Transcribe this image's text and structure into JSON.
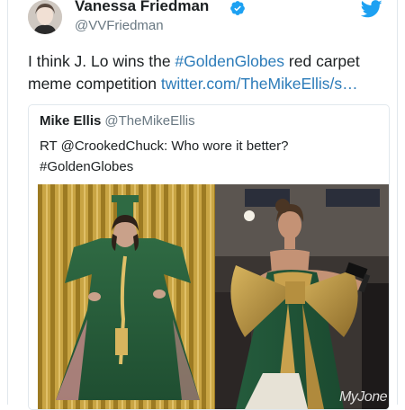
{
  "tweet": {
    "author_name": "Vanessa Friedman",
    "author_handle": "@VVFriedman",
    "text_prefix": "I think J. Lo wins the ",
    "hashtag": "#GoldenGlobes",
    "text_middle": " red carpet meme competition ",
    "link": "twitter.com/TheMikeEllis/s…"
  },
  "quoted": {
    "author_name": "Mike Ellis",
    "author_handle": "@TheMikeEllis",
    "text_line1": "RT @CrookedChuck: Who wore it better?",
    "text_line2": "#GoldenGlobes"
  },
  "media": {
    "watermark": "MyJone"
  },
  "colors": {
    "link": "#2b7bb9",
    "twitter_blue": "#1da1f2",
    "text": "#1c2022",
    "muted": "#697882"
  },
  "icons": {
    "verified": "verified-badge-icon",
    "brand": "twitter-bird-icon"
  }
}
